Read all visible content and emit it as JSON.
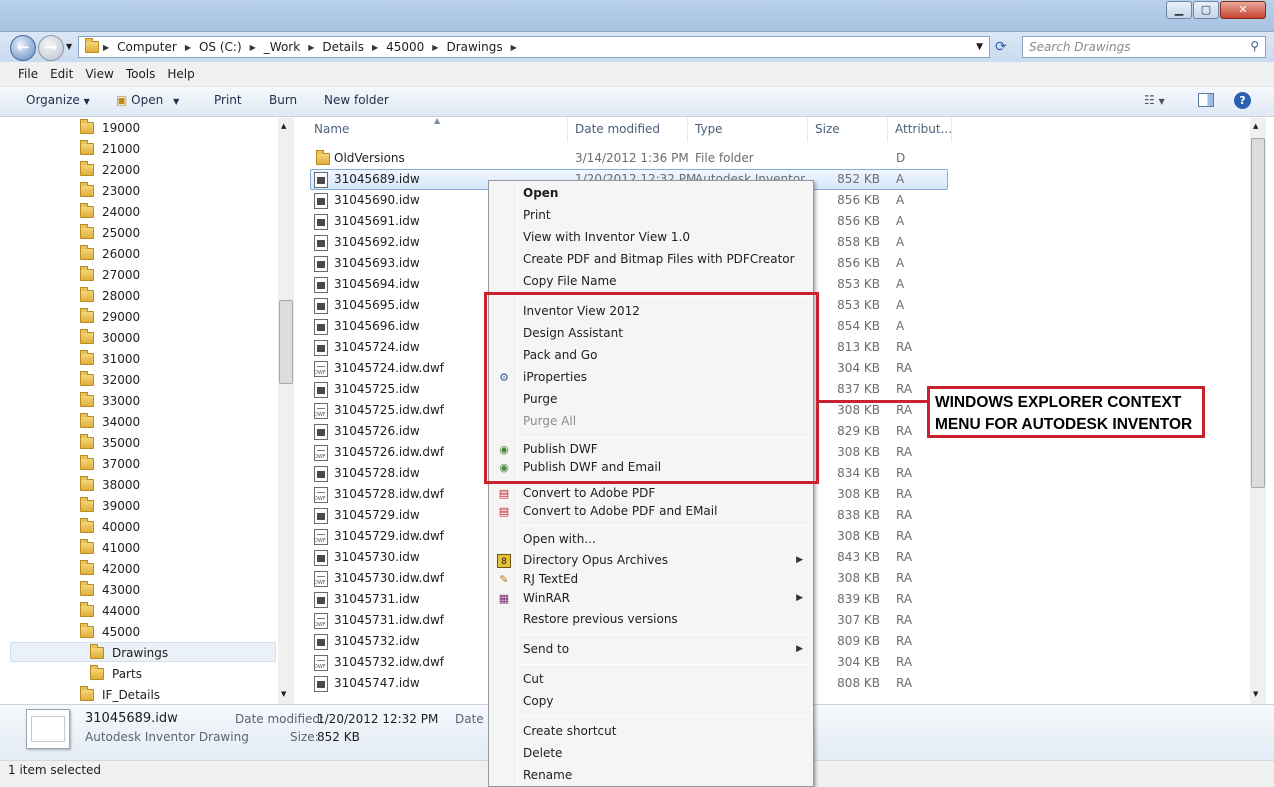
{
  "address": {
    "crumbs": [
      "Computer",
      "OS (C:)",
      "_Work",
      "Details",
      "45000",
      "Drawings"
    ],
    "search_placeholder": "Search Drawings"
  },
  "menubar": [
    "File",
    "Edit",
    "View",
    "Tools",
    "Help"
  ],
  "toolbar": {
    "organize": "Organize",
    "open": "Open",
    "print": "Print",
    "burn": "Burn",
    "new_folder": "New folder"
  },
  "tree": [
    "19000",
    "21000",
    "22000",
    "23000",
    "24000",
    "25000",
    "26000",
    "27000",
    "28000",
    "29000",
    "30000",
    "31000",
    "32000",
    "33000",
    "34000",
    "35000",
    "37000",
    "38000",
    "39000",
    "40000",
    "41000",
    "42000",
    "43000",
    "44000",
    "45000",
    "Drawings",
    "Parts",
    "IF_Details"
  ],
  "columns": {
    "name": "Name",
    "date": "Date modified",
    "type": "Type",
    "size": "Size",
    "attr": "Attribut..."
  },
  "files": [
    {
      "name": "OldVersions",
      "date": "3/14/2012 1:36 PM",
      "type": "File folder",
      "size": "",
      "attr": "D",
      "kind": "folder"
    },
    {
      "name": "31045689.idw",
      "date": "1/20/2012 12:32 PM",
      "type": "Autodesk Inventor...",
      "size": "852 KB",
      "attr": "A",
      "kind": "idw"
    },
    {
      "name": "31045690.idw",
      "date": "",
      "type": "",
      "size": "856 KB",
      "attr": "A",
      "kind": "idw"
    },
    {
      "name": "31045691.idw",
      "date": "",
      "type": "",
      "size": "856 KB",
      "attr": "A",
      "kind": "idw"
    },
    {
      "name": "31045692.idw",
      "date": "",
      "type": "",
      "size": "858 KB",
      "attr": "A",
      "kind": "idw"
    },
    {
      "name": "31045693.idw",
      "date": "",
      "type": "",
      "size": "856 KB",
      "attr": "A",
      "kind": "idw"
    },
    {
      "name": "31045694.idw",
      "date": "",
      "type": "",
      "size": "853 KB",
      "attr": "A",
      "kind": "idw"
    },
    {
      "name": "31045695.idw",
      "date": "",
      "type": "",
      "size": "853 KB",
      "attr": "A",
      "kind": "idw"
    },
    {
      "name": "31045696.idw",
      "date": "",
      "type": "",
      "size": "854 KB",
      "attr": "A",
      "kind": "idw"
    },
    {
      "name": "31045724.idw",
      "date": "",
      "type": "",
      "size": "813 KB",
      "attr": "RA",
      "kind": "idw"
    },
    {
      "name": "31045724.idw.dwf",
      "date": "",
      "type": "",
      "size": "304 KB",
      "attr": "RA",
      "kind": "dwf"
    },
    {
      "name": "31045725.idw",
      "date": "",
      "type": "",
      "size": "837 KB",
      "attr": "RA",
      "kind": "idw"
    },
    {
      "name": "31045725.idw.dwf",
      "date": "",
      "type": "",
      "size": "308 KB",
      "attr": "RA",
      "kind": "dwf"
    },
    {
      "name": "31045726.idw",
      "date": "",
      "type": "",
      "size": "829 KB",
      "attr": "RA",
      "kind": "idw"
    },
    {
      "name": "31045726.idw.dwf",
      "date": "",
      "type": "",
      "size": "308 KB",
      "attr": "RA",
      "kind": "dwf"
    },
    {
      "name": "31045728.idw",
      "date": "",
      "type": "",
      "size": "834 KB",
      "attr": "RA",
      "kind": "idw"
    },
    {
      "name": "31045728.idw.dwf",
      "date": "",
      "type": "",
      "size": "308 KB",
      "attr": "RA",
      "kind": "dwf"
    },
    {
      "name": "31045729.idw",
      "date": "",
      "type": "",
      "size": "838 KB",
      "attr": "RA",
      "kind": "idw"
    },
    {
      "name": "31045729.idw.dwf",
      "date": "",
      "type": "",
      "size": "308 KB",
      "attr": "RA",
      "kind": "dwf"
    },
    {
      "name": "31045730.idw",
      "date": "",
      "type": "",
      "size": "843 KB",
      "attr": "RA",
      "kind": "idw"
    },
    {
      "name": "31045730.idw.dwf",
      "date": "",
      "type": "",
      "size": "308 KB",
      "attr": "RA",
      "kind": "dwf"
    },
    {
      "name": "31045731.idw",
      "date": "",
      "type": "",
      "size": "839 KB",
      "attr": "RA",
      "kind": "idw"
    },
    {
      "name": "31045731.idw.dwf",
      "date": "",
      "type": "",
      "size": "307 KB",
      "attr": "RA",
      "kind": "dwf"
    },
    {
      "name": "31045732.idw",
      "date": "",
      "type": "",
      "size": "809 KB",
      "attr": "RA",
      "kind": "idw"
    },
    {
      "name": "31045732.idw.dwf",
      "date": "",
      "type": "",
      "size": "304 KB",
      "attr": "RA",
      "kind": "dwf"
    },
    {
      "name": "31045747.idw",
      "date": "",
      "type": "",
      "size": "808 KB",
      "attr": "RA",
      "kind": "idw"
    }
  ],
  "context_menu": {
    "open": "Open",
    "print": "Print",
    "view_with": "View with Inventor View 1.0",
    "create_pdf": "Create PDF and Bitmap Files with PDFCreator",
    "copy_file_name": "Copy File Name",
    "inventor_view": "Inventor View 2012",
    "design_assistant": "Design Assistant",
    "pack_and_go": "Pack and Go",
    "iproperties": "iProperties",
    "purge": "Purge",
    "purge_all": "Purge All",
    "publish_dwf": "Publish DWF",
    "publish_dwf_email": "Publish DWF and Email",
    "convert_pdf": "Convert to Adobe PDF",
    "convert_pdf_email": "Convert to Adobe PDF and EMail",
    "open_with": "Open with...",
    "dopus": "Directory Opus Archives",
    "rj_texted": "RJ TextEd",
    "winrar": "WinRAR",
    "restore": "Restore previous versions",
    "send_to": "Send to",
    "cut": "Cut",
    "copy": "Copy",
    "create_shortcut": "Create shortcut",
    "delete": "Delete",
    "rename": "Rename"
  },
  "details": {
    "filename": "31045689.idw",
    "filetype": "Autodesk Inventor Drawing",
    "date_label": "Date modified:",
    "date_value": "1/20/2012 12:32 PM",
    "date_label2": "Date c",
    "size_label": "Size:",
    "size_value": "852 KB"
  },
  "status": "1 item selected",
  "annotation": {
    "line1": "WINDOWS EXPLORER CONTEXT",
    "line2": "MENU FOR AUTODESK INVENTOR"
  },
  "colors": {
    "highlight": "#c8242f",
    "selection": "#d5e7fb"
  }
}
